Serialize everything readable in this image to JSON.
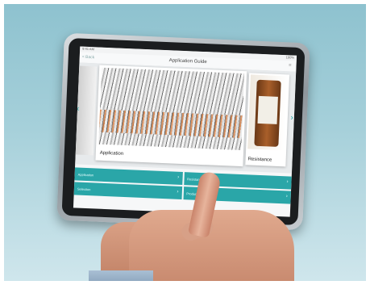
{
  "statusbar": {
    "time": "9:41 AM",
    "battery": "100%"
  },
  "navbar": {
    "back_label": "< Back",
    "title": "Application Guide",
    "menu_icon": "≡"
  },
  "gallery": {
    "main_label": "Application",
    "right_label": "Resistance",
    "prev_icon": "‹",
    "next_icon": "›"
  },
  "tiles": [
    {
      "label": "Application",
      "chevron": "›"
    },
    {
      "label": "Resistance",
      "chevron": "›"
    },
    {
      "label": "Selection",
      "chevron": "›"
    },
    {
      "label": "Products",
      "chevron": "›"
    }
  ],
  "colors": {
    "accent": "#2aa6a8",
    "background": "#a6d0da"
  }
}
